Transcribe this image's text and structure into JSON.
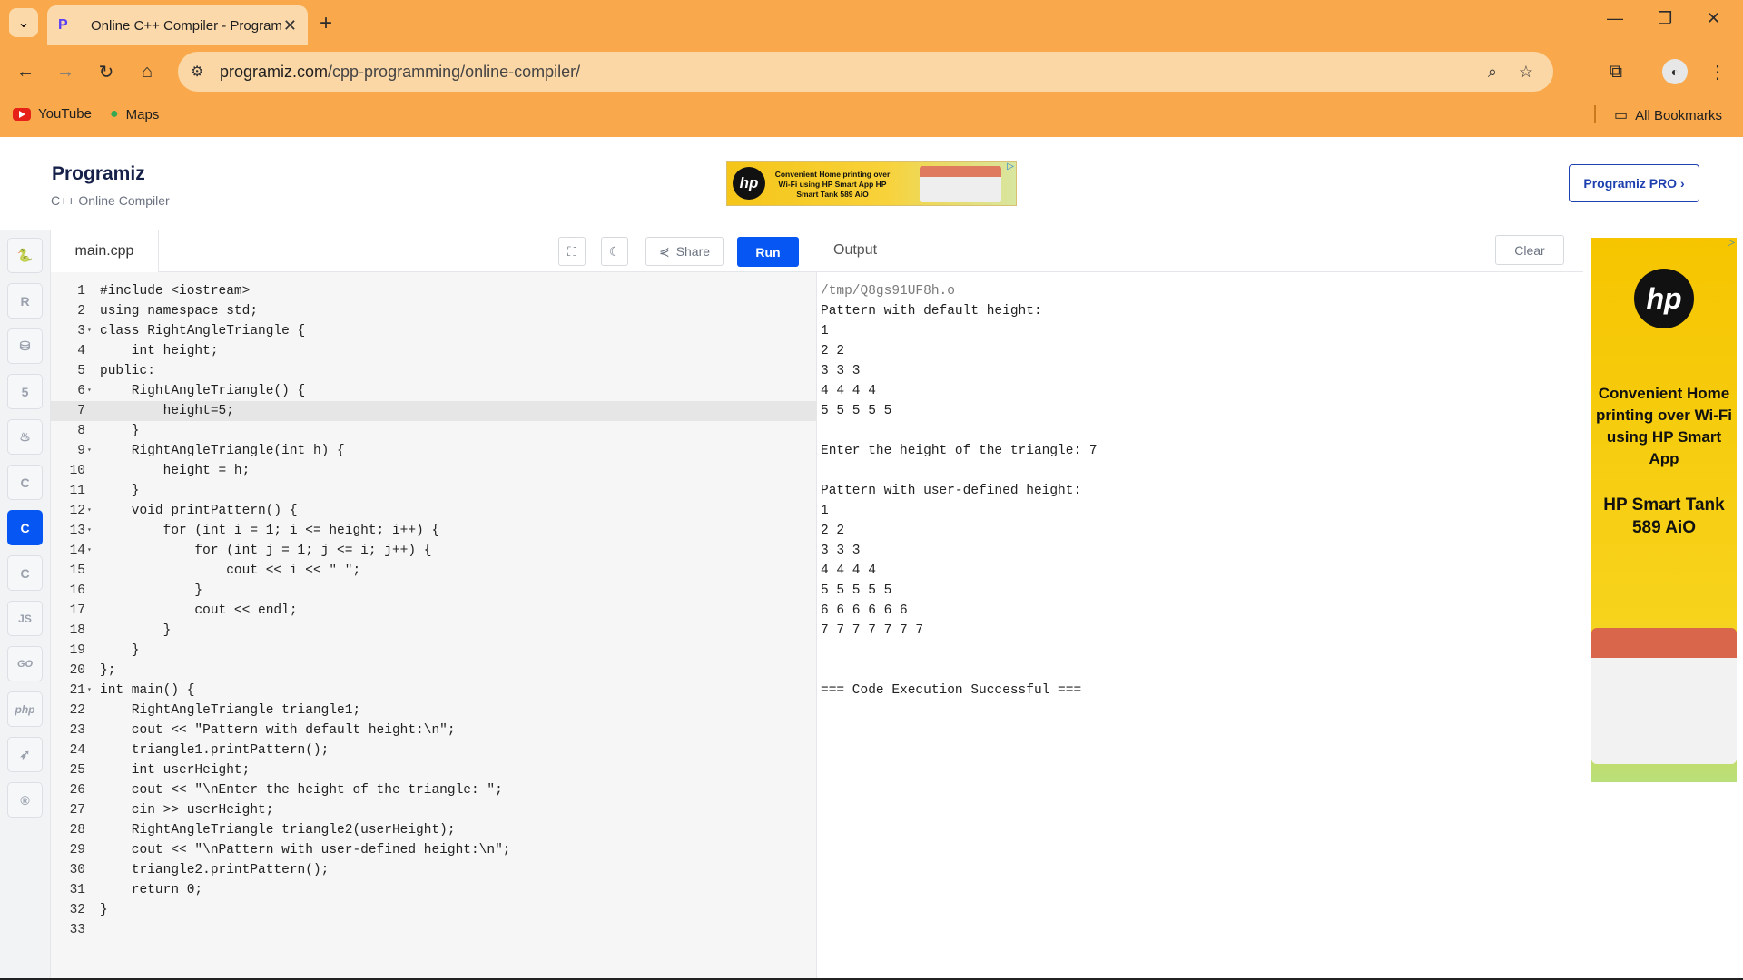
{
  "browser": {
    "tab_title": "Online C++ Compiler - Program",
    "url_host": "programiz.com",
    "url_path": "/cpp-programming/online-compiler/",
    "bookmarks": [
      "YouTube",
      "Maps"
    ],
    "all_bookmarks": "All Bookmarks"
  },
  "site": {
    "logo": "Programiz",
    "subtitle": "C++ Online Compiler",
    "pro_button": "Programiz PRO ›",
    "banner_ad": "Convenient Home printing over Wi-Fi using HP Smart App HP Smart Tank 589 AiO",
    "side_ad_line1": "Convenient Home printing over Wi-Fi using HP Smart App",
    "side_ad_line2": "HP Smart Tank 589 AiO"
  },
  "languages": [
    "python",
    "r",
    "sql",
    "html",
    "java",
    "c",
    "cpp",
    "csharp",
    "JS",
    "GO",
    "php",
    "swift",
    "rust"
  ],
  "editor": {
    "file_name": "main.cpp",
    "share_label": "Share",
    "run_label": "Run",
    "active_line": 7,
    "lines": [
      "#include <iostream>",
      "using namespace std;",
      "class RightAngleTriangle {",
      "    int height;",
      "public:",
      "    RightAngleTriangle() {",
      "        height=5;",
      "    }",
      "    RightAngleTriangle(int h) {",
      "        height = h;",
      "    }",
      "    void printPattern() {",
      "        for (int i = 1; i <= height; i++) {",
      "            for (int j = 1; j <= i; j++) {",
      "                cout << i << \" \";",
      "            }",
      "            cout << endl;",
      "        }",
      "    }",
      "};",
      "int main() {",
      "    RightAngleTriangle triangle1;",
      "    cout << \"Pattern with default height:\\n\";",
      "    triangle1.printPattern();",
      "    int userHeight;",
      "    cout << \"\\nEnter the height of the triangle: \";",
      "    cin >> userHeight;",
      "    RightAngleTriangle triangle2(userHeight);",
      "    cout << \"\\nPattern with user-defined height:\\n\";",
      "    triangle2.printPattern();",
      "    return 0;",
      "}",
      ""
    ],
    "fold_lines": [
      3,
      6,
      9,
      12,
      13,
      14,
      21
    ]
  },
  "output": {
    "title": "Output",
    "clear_label": "Clear",
    "lines": [
      "/tmp/Q8gs91UF8h.o",
      "Pattern with default height:",
      "1",
      "2 2",
      "3 3 3",
      "4 4 4 4",
      "5 5 5 5 5",
      "",
      "Enter the height of the triangle: 7",
      "",
      "Pattern with user-defined height:",
      "1",
      "2 2",
      "3 3 3",
      "4 4 4 4",
      "5 5 5 5 5",
      "6 6 6 6 6 6",
      "7 7 7 7 7 7 7",
      "",
      "",
      "=== Code Execution Successful ==="
    ]
  }
}
